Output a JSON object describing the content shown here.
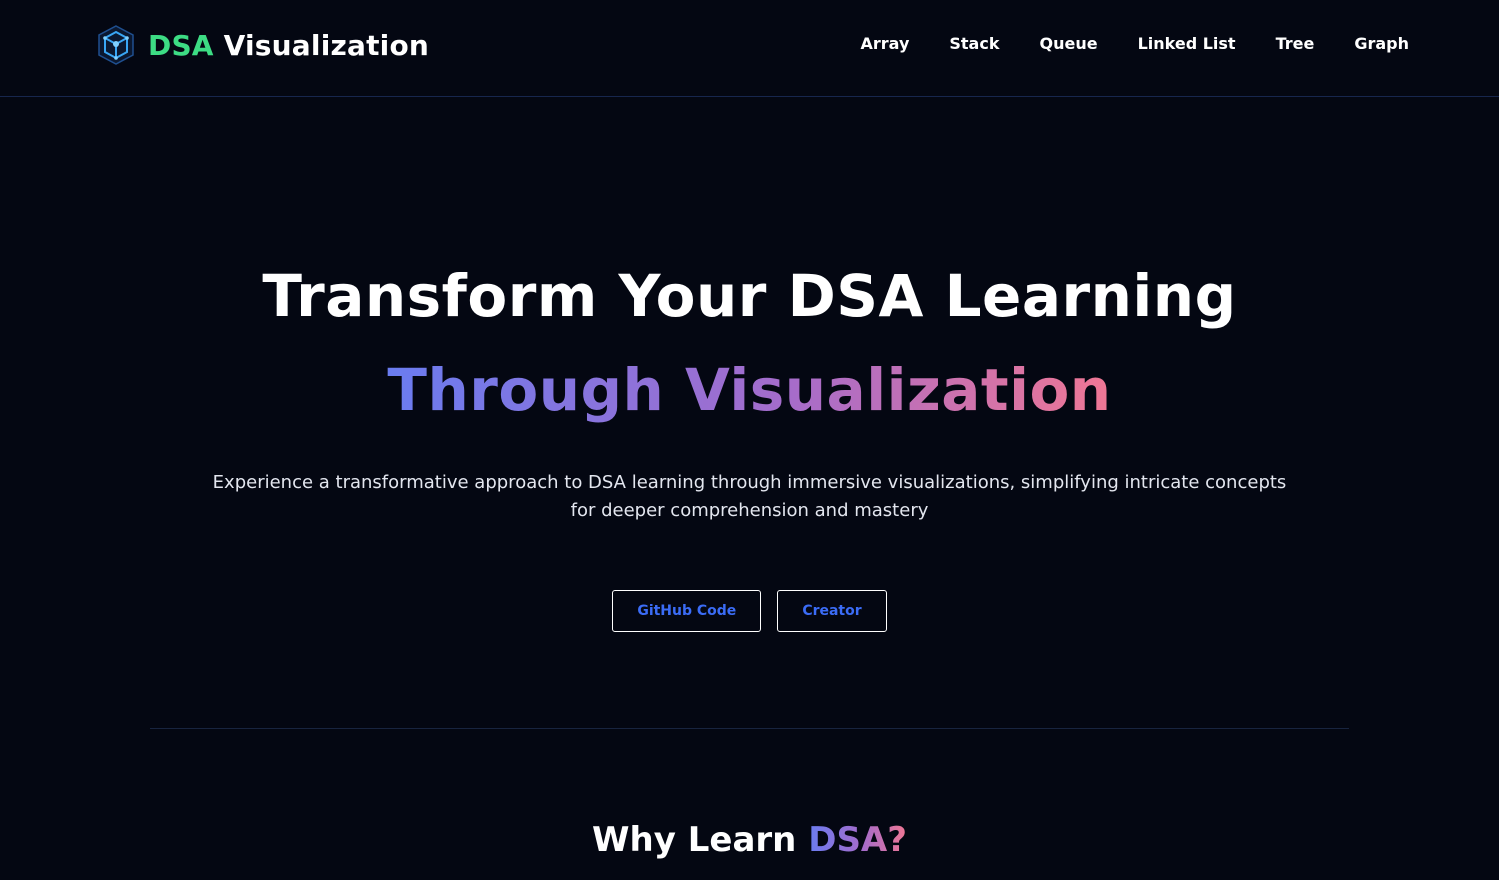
{
  "brand": {
    "accent": "DSA",
    "rest": " Visualization",
    "logo_icon": "hexagon-cube-icon",
    "accent_color": "#3ddc84"
  },
  "nav": {
    "items": [
      {
        "label": "Array"
      },
      {
        "label": "Stack"
      },
      {
        "label": "Queue"
      },
      {
        "label": "Linked List"
      },
      {
        "label": "Tree"
      },
      {
        "label": "Graph"
      }
    ]
  },
  "hero": {
    "title": "Transform Your DSA Learning",
    "subtitle": "Through Visualization",
    "description": "Experience a transformative approach to DSA learning through immersive visualizations, simplifying intricate concepts for deeper comprehension and mastery",
    "gradient_colors": [
      "#6a7cf0",
      "#a56ccb",
      "#f07794"
    ]
  },
  "cta": {
    "github_label": "GitHub Code",
    "creator_label": "Creator",
    "text_color": "#3b6cf6"
  },
  "why_section": {
    "title_plain": "Why Learn ",
    "title_accent": "DSA?"
  }
}
